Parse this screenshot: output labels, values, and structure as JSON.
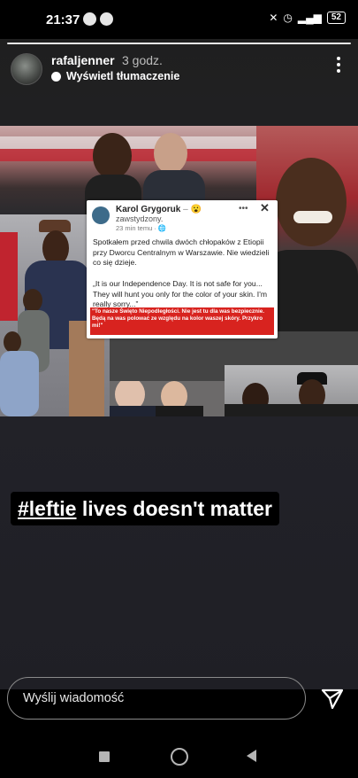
{
  "status_bar": {
    "time": "21:37",
    "battery": "52"
  },
  "story": {
    "username": "rafaljenner",
    "time_ago": "3 godz.",
    "translate_label": "Wyświetl tłumaczenie",
    "caption_hashtag": "#leftie",
    "caption_rest": " lives doesn't matter"
  },
  "post": {
    "author": "Karol Grygoruk",
    "author_suffix": "– 😮",
    "feeling": "zawstydzony.",
    "time": "23 min temu · 🌐",
    "text_polish": "Spotkałem przed chwila dwóch chłopaków z Etiopii przy Dworcu Centralnym w Warszawie. Nie wiedzieli co się dzieje.",
    "text_quote": "„It is our Independence Day. It is not safe for you... They will hunt you only for the color of your skin. I'm really sorry...”",
    "text_translation": "\"To nasze Święto Niepodległości. Nie jest tu dla was bezpiecznie. Będą na was polować ze względu na kolor waszej skóry. Przykro mi!\""
  },
  "reply": {
    "placeholder": "Wyślij wiadomość"
  },
  "colors": {
    "background": "#000000",
    "story_bg": "#202024",
    "post_red": "#d8231f"
  }
}
